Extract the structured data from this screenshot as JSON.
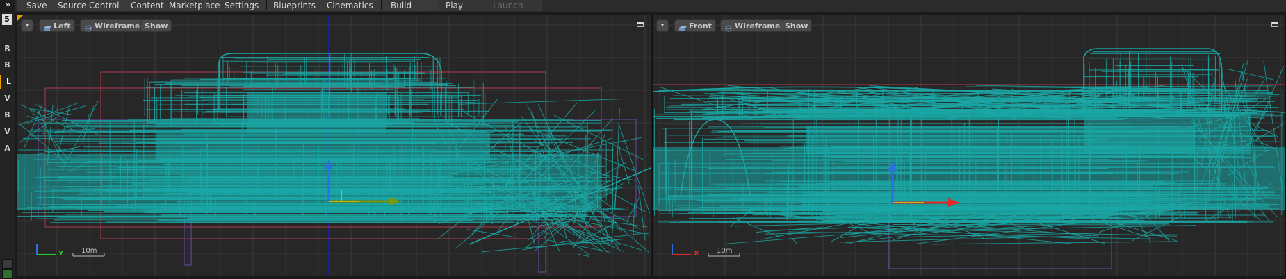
{
  "toolbar": {
    "expand_glyph": "»",
    "items": [
      {
        "label": "Save",
        "disabled": false
      },
      {
        "label": "Source Control",
        "disabled": false
      },
      {
        "label": "Content",
        "disabled": false
      },
      {
        "label": "Marketplace",
        "disabled": false
      },
      {
        "label": "Settings",
        "disabled": false
      },
      {
        "label": "Blueprints",
        "disabled": false
      },
      {
        "label": "Cinematics",
        "disabled": false
      },
      {
        "label": "Build",
        "disabled": false
      },
      {
        "label": "Play",
        "disabled": false
      },
      {
        "label": "Launch",
        "disabled": true
      }
    ]
  },
  "sidebar": {
    "top_glyph": "5",
    "items": [
      "R",
      "B",
      "L",
      "V",
      "B",
      "V",
      "A"
    ],
    "active_index": 2
  },
  "viewports": {
    "left": {
      "menu_glyph": "▾",
      "view_label": "Left",
      "mode_label": "Wireframe",
      "show_label": "Show",
      "scale_label": "10m",
      "axis_horizontal": "Y",
      "axis_vertical": "Z",
      "axis_h_color": "#1ecf1e",
      "axis_v_color": "#2b6fe0"
    },
    "right": {
      "menu_glyph": "▾",
      "view_label": "Front",
      "mode_label": "Wireframe",
      "show_label": "Show",
      "scale_label": "10m",
      "axis_horizontal": "X",
      "axis_vertical": "Z",
      "axis_h_color": "#e02b2b",
      "axis_v_color": "#2b6fe0"
    }
  },
  "colors": {
    "wireframe": "#1aa7a5",
    "grid": "#3a3a3a",
    "grid_major": "#4a4a4a",
    "axis_blue": "#1f1fb0",
    "bounds_red": "#b23a4a",
    "bounds_purple": "#6b4aa8"
  },
  "icons": {
    "perspective": "cube-view-icon",
    "wireframe": "wireframe-sphere-icon",
    "maximize": "maximize-viewport-icon"
  }
}
